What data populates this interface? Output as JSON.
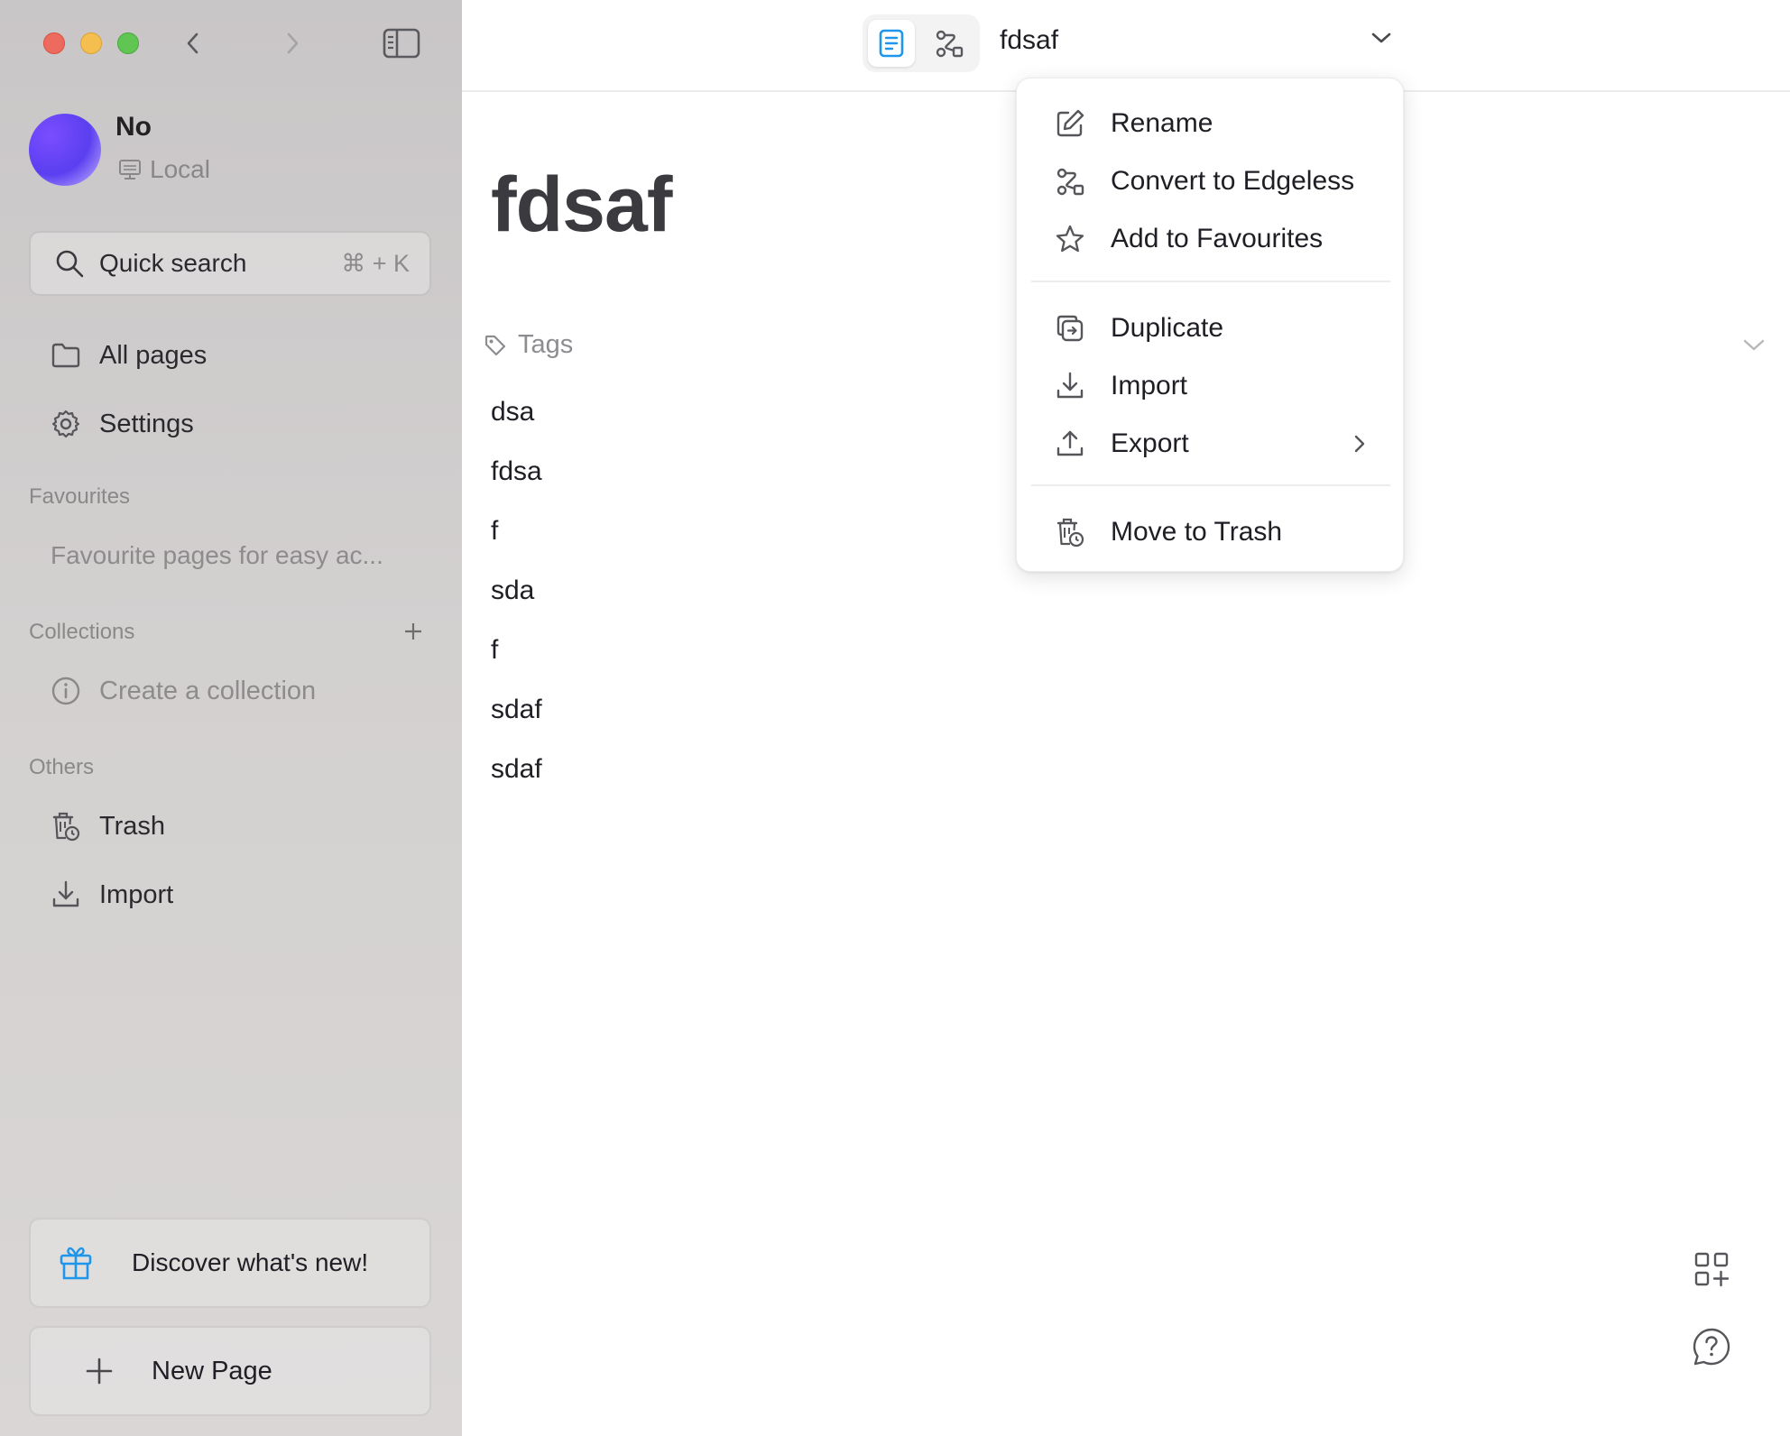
{
  "sidebar": {
    "workspace": {
      "name": "No",
      "type": "Local"
    },
    "search": {
      "label": "Quick search",
      "shortcut": "⌘ + K"
    },
    "nav": [
      {
        "label": "All pages",
        "icon": "folder-icon"
      },
      {
        "label": "Settings",
        "icon": "gear-icon"
      }
    ],
    "favourites": {
      "title": "Favourites",
      "empty": "Favourite pages for easy ac..."
    },
    "collections": {
      "title": "Collections",
      "create": "Create a collection"
    },
    "others": {
      "title": "Others",
      "items": [
        {
          "label": "Trash",
          "icon": "trash-icon"
        },
        {
          "label": "Import",
          "icon": "import-icon"
        }
      ]
    },
    "whats_new": "Discover what's new!",
    "new_page": "New Page"
  },
  "topbar": {
    "doc_title": "fdsaf"
  },
  "page": {
    "title": "fdsaf",
    "tags_label": "Tags",
    "paragraphs": [
      "dsa",
      "fdsa",
      "f",
      "sda",
      "f",
      "sdaf",
      "sdaf"
    ]
  },
  "menu": {
    "items": [
      {
        "label": "Rename",
        "icon": "edit-icon"
      },
      {
        "label": "Convert to Edgeless",
        "icon": "edgeless-icon"
      },
      {
        "label": "Add to Favourites",
        "icon": "star-icon"
      },
      {
        "label": "Duplicate",
        "icon": "duplicate-icon"
      },
      {
        "label": "Import",
        "icon": "import-icon"
      },
      {
        "label": "Export",
        "icon": "export-icon"
      },
      {
        "label": "Move to Trash",
        "icon": "trash-icon"
      }
    ]
  },
  "colors": {
    "accent": "#1e96eb",
    "sidebar_bg": "#cfcccc"
  }
}
